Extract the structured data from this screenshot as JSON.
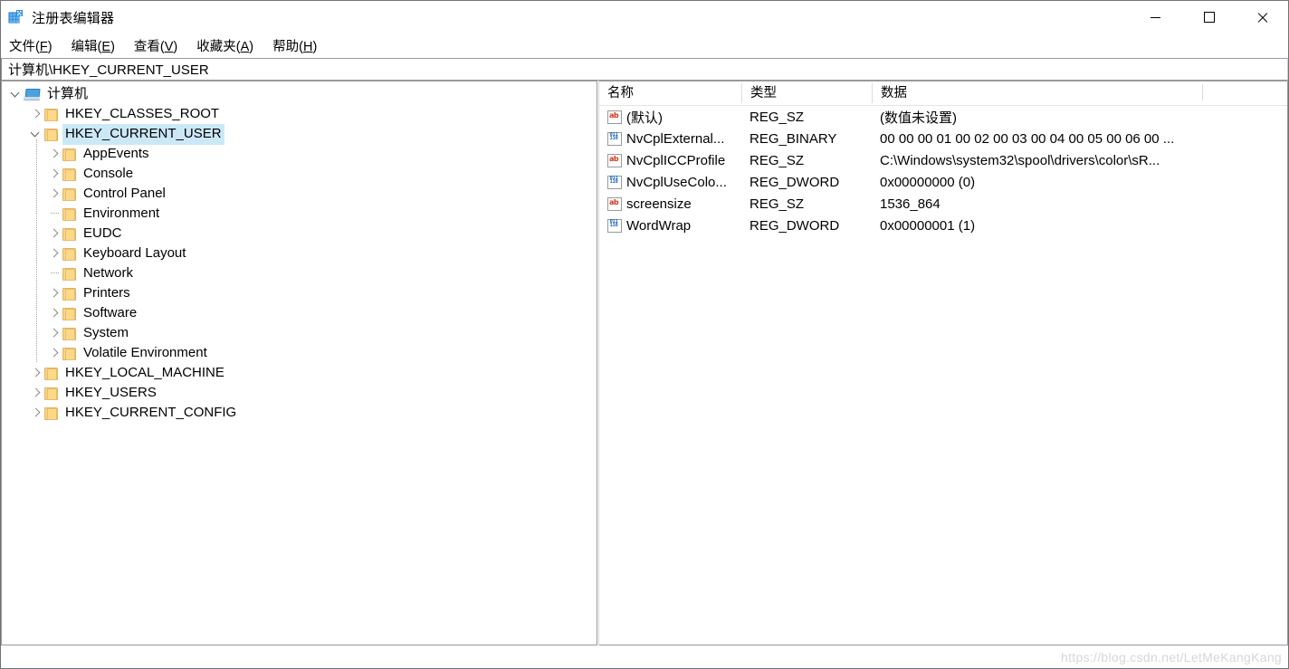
{
  "window": {
    "title": "注册表编辑器",
    "icon": "registry-editor-icon",
    "controls": {
      "minimize": "—",
      "maximize": "□",
      "close": "✕"
    }
  },
  "menubar": [
    {
      "name": "file",
      "text": "文件",
      "accel": "F"
    },
    {
      "name": "edit",
      "text": "编辑",
      "accel": "E"
    },
    {
      "name": "view",
      "text": "查看",
      "accel": "V"
    },
    {
      "name": "favorites",
      "text": "收藏夹",
      "accel": "A"
    },
    {
      "name": "help",
      "text": "帮助",
      "accel": "H"
    }
  ],
  "address": {
    "value": "计算机\\HKEY_CURRENT_USER"
  },
  "tree": {
    "root": {
      "label": "计算机",
      "expanded": true
    },
    "nodes": [
      {
        "label": "HKEY_CLASSES_ROOT",
        "level": 1,
        "state": "collapsed",
        "selected": false
      },
      {
        "label": "HKEY_CURRENT_USER",
        "level": 1,
        "state": "expanded",
        "selected": true
      },
      {
        "label": "AppEvents",
        "level": 2,
        "state": "collapsed",
        "selected": false
      },
      {
        "label": "Console",
        "level": 2,
        "state": "collapsed",
        "selected": false
      },
      {
        "label": "Control Panel",
        "level": 2,
        "state": "collapsed",
        "selected": false
      },
      {
        "label": "Environment",
        "level": 2,
        "state": "leaf",
        "selected": false
      },
      {
        "label": "EUDC",
        "level": 2,
        "state": "collapsed",
        "selected": false
      },
      {
        "label": "Keyboard Layout",
        "level": 2,
        "state": "collapsed",
        "selected": false
      },
      {
        "label": "Network",
        "level": 2,
        "state": "leaf",
        "selected": false
      },
      {
        "label": "Printers",
        "level": 2,
        "state": "collapsed",
        "selected": false
      },
      {
        "label": "Software",
        "level": 2,
        "state": "collapsed",
        "selected": false
      },
      {
        "label": "System",
        "level": 2,
        "state": "collapsed",
        "selected": false
      },
      {
        "label": "Volatile Environment",
        "level": 2,
        "state": "collapsed",
        "selected": false
      },
      {
        "label": "HKEY_LOCAL_MACHINE",
        "level": 1,
        "state": "collapsed",
        "selected": false
      },
      {
        "label": "HKEY_USERS",
        "level": 1,
        "state": "collapsed",
        "selected": false
      },
      {
        "label": "HKEY_CURRENT_CONFIG",
        "level": 1,
        "state": "collapsed",
        "selected": false
      }
    ]
  },
  "list": {
    "columns": [
      {
        "key": "name",
        "label": "名称"
      },
      {
        "key": "type",
        "label": "类型"
      },
      {
        "key": "data",
        "label": "数据"
      }
    ],
    "rows": [
      {
        "icon": "string-value-icon",
        "name": "(默认)",
        "type": "REG_SZ",
        "data": "(数值未设置)"
      },
      {
        "icon": "binary-value-icon",
        "name": "NvCplExternal...",
        "type": "REG_BINARY",
        "data": "00 00 00 01 00 02 00 03 00 04 00 05 00 06 00 ..."
      },
      {
        "icon": "string-value-icon",
        "name": "NvCplICCProfile",
        "type": "REG_SZ",
        "data": "C:\\Windows\\system32\\spool\\drivers\\color\\sR..."
      },
      {
        "icon": "binary-value-icon",
        "name": "NvCplUseColo...",
        "type": "REG_DWORD",
        "data": "0x00000000 (0)"
      },
      {
        "icon": "string-value-icon",
        "name": "screensize",
        "type": "REG_SZ",
        "data": "1536_864"
      },
      {
        "icon": "binary-value-icon",
        "name": "WordWrap",
        "type": "REG_DWORD",
        "data": "0x00000001 (1)"
      }
    ]
  },
  "statusbar": {
    "text": ""
  },
  "watermark": {
    "text": "https://blog.csdn.net/LetMeKangKang"
  },
  "colors": {
    "selection": "#cce8f7",
    "folder": "#fcd888",
    "string_icon": "#d4351c",
    "binary_icon": "#1560bd",
    "border": "#9a9a9a"
  }
}
